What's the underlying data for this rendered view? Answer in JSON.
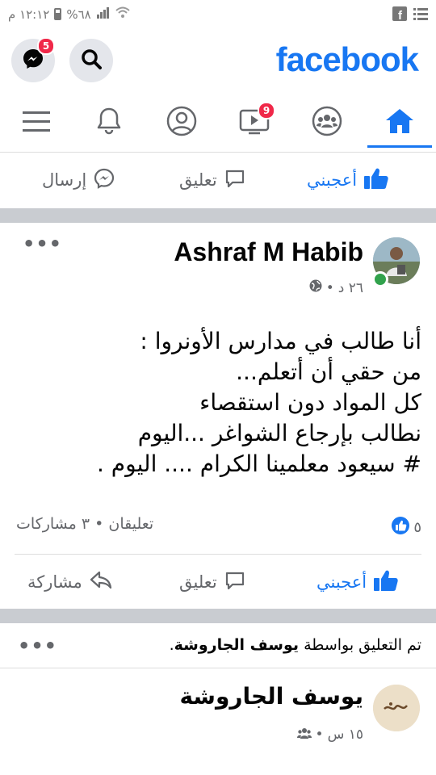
{
  "status_bar": {
    "time": "١٢:١٢ م",
    "battery": "%٦٨"
  },
  "header": {
    "logo": "facebook",
    "messenger_badge": "5"
  },
  "nav": {
    "video_badge": "9"
  },
  "prev_actions": {
    "like": "أعجبني",
    "comment": "تعليق",
    "send": "إرسال"
  },
  "post": {
    "author": "Ashraf M Habib",
    "time": "٢٦ د",
    "lines": [
      "أنا طالب في مدارس الأونروا :",
      "من حقي أن أتعلم...",
      "كل المواد دون استقصاء",
      "نطالب بإرجاع الشواغر ...اليوم",
      "# سيعود معلمينا الكرام .... اليوم ."
    ],
    "reactions_count": "٥",
    "stats": "تعليقان • ٣ مشاركات",
    "actions": {
      "like": "أعجبني",
      "comment": "تعليق",
      "share": "مشاركة"
    }
  },
  "next_post": {
    "context_prefix": "تم التعليق بواسطة",
    "context_name": "يوسف الجاروشة",
    "author": "يوسف الجاروشة",
    "time": "١٥ س"
  },
  "colors": {
    "brand": "#1877f2",
    "separator": "#c9ccd1",
    "badge": "#f02849",
    "online": "#31a24c"
  }
}
